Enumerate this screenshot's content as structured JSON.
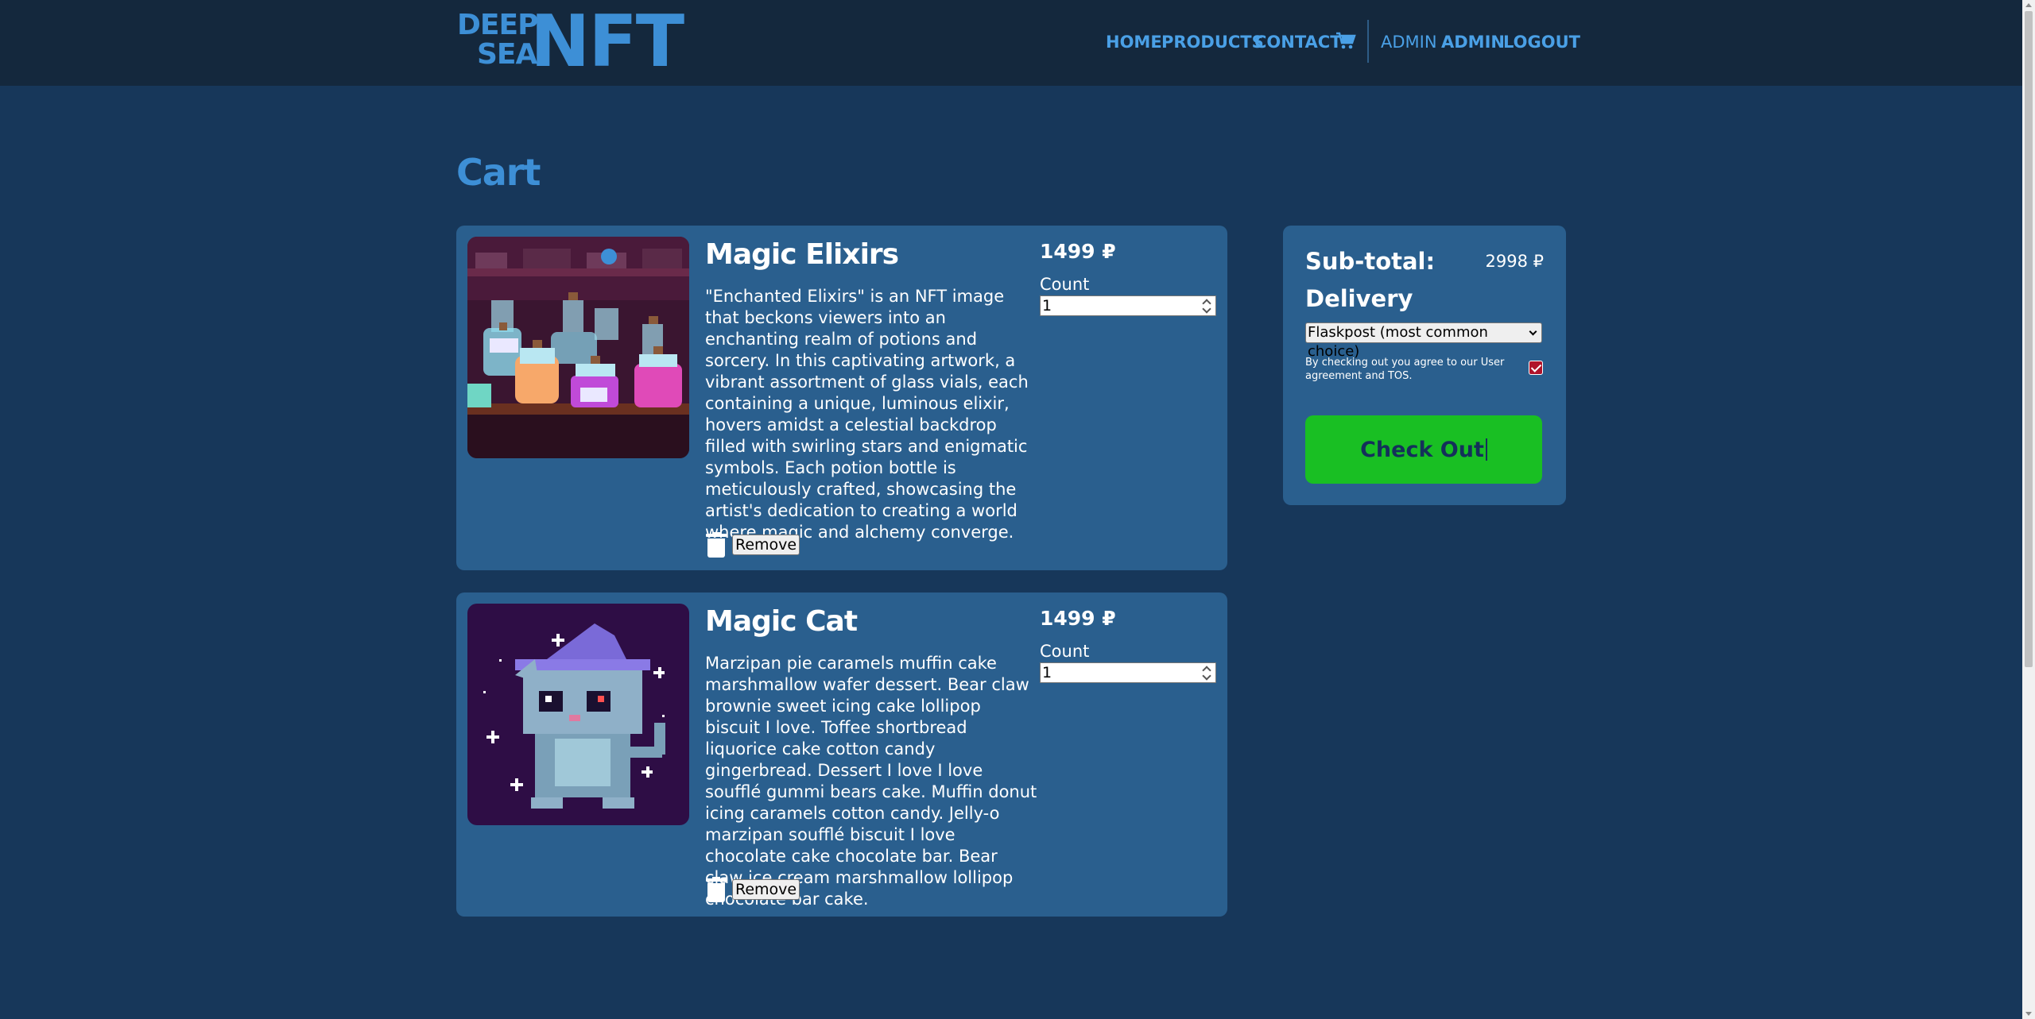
{
  "brand": {
    "line1": "DEEP",
    "line2": "SEA",
    "big": "NFT"
  },
  "nav": {
    "links": [
      "HOME",
      "PRODUCTS",
      "CONTACT"
    ],
    "cart_icon": "cart-icon",
    "admin_plain": "ADMIN",
    "admin_bold": "ADMIN",
    "logout": "LOGOUT"
  },
  "page": {
    "title": "Cart"
  },
  "cart": {
    "items": [
      {
        "name": "Magic Elixirs",
        "price": "1499 ₽",
        "count_label": "Count",
        "count": "1",
        "description": "\"Enchanted Elixirs\" is an NFT image that beckons viewers into an enchanting realm of potions and sorcery. In this captivating artwork, a vibrant assortment of glass vials, each containing a unique, luminous elixir, hovers amidst a celestial backdrop filled with swirling stars and enigmatic symbols. Each potion bottle is meticulously crafted, showcasing the artist's dedication to creating a world where magic and alchemy converge.",
        "remove_label": "Remove"
      },
      {
        "name": "Magic Cat",
        "price": "1499 ₽",
        "count_label": "Count",
        "count": "1",
        "description": "Marzipan pie caramels muffin cake marshmallow wafer dessert. Bear claw brownie sweet icing cake lollipop biscuit I love. Toffee shortbread liquorice cake cotton candy gingerbread. Dessert I love I love soufflé gummi bears cake. Muffin donut icing caramels cotton candy. Jelly-o marzipan soufflé biscuit I love chocolate cake chocolate bar. Bear claw ice cream marshmallow lollipop chocolate bar cake.",
        "remove_label": "Remove"
      }
    ]
  },
  "summary": {
    "subtotal_label": "Sub-total:",
    "subtotal_value": "2998 ₽",
    "delivery_label": "Delivery",
    "delivery_selected": "Flaskpost (most common choice)",
    "tos_text": "By checking out you agree to our User agreement and TOS.",
    "tos_checked": true,
    "checkout_label": "Check Out"
  },
  "colors": {
    "background": "#17375a",
    "header": "#14283d",
    "card": "#2a5f8e",
    "accent": "#3d8fd6",
    "checkout": "#19bf23",
    "checkbox": "#b0132a"
  }
}
